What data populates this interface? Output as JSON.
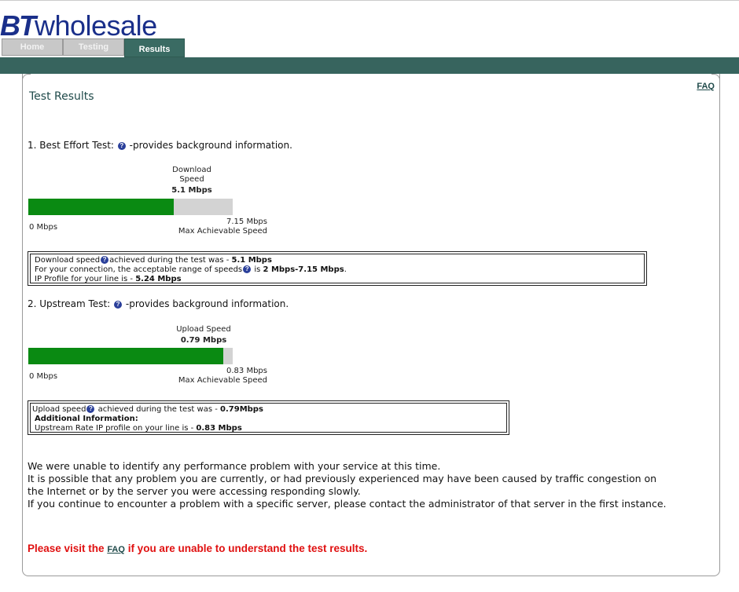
{
  "brand": {
    "bt": "BT",
    "wholesale": "wholesale",
    "color": "#1a2f8a"
  },
  "tabs": [
    {
      "label": "Home",
      "active": false
    },
    {
      "label": "Testing",
      "active": false
    },
    {
      "label": "Results",
      "active": true
    }
  ],
  "faq_link": "FAQ",
  "title": "Test Results",
  "sections": {
    "best_effort": {
      "heading_prefix": "1. Best Effort Test:",
      "heading_suffix": "-provides background information.",
      "speed_label_line1": "Download",
      "speed_label_line2": "Speed",
      "speed_value": "5.1 Mbps",
      "speed_fraction": 0.713,
      "min_label": "0 Mbps",
      "max_value": "7.15 Mbps",
      "max_label": "Max Achievable Speed",
      "info": {
        "line1_prefix": "Download speed",
        "line1_mid": "achieved during the test was - ",
        "line1_value": "5.1 Mbps",
        "line2_prefix": "For your connection, the acceptable range of speeds",
        "line2_mid": " is ",
        "line2_value": "2 Mbps-7.15 Mbps",
        "line2_end": ".",
        "line3_prefix": "IP Profile for your line is - ",
        "line3_value": "5.24 Mbps"
      }
    },
    "upstream": {
      "heading_prefix": "2. Upstream Test:",
      "heading_suffix": "-provides background information.",
      "speed_label": "Upload Speed",
      "speed_value": "0.79 Mbps",
      "speed_fraction": 0.952,
      "min_label": "0 Mbps",
      "max_value": "0.83 Mbps",
      "max_label": "Max Achievable Speed",
      "info": {
        "line1_prefix": "Upload speed",
        "line1_mid": " achieved during the test was - ",
        "line1_value": "0.79Mbps",
        "line2": "Additional Information:",
        "line3_prefix": "Upstream Rate IP profile on your line is - ",
        "line3_value": "0.83 Mbps"
      }
    }
  },
  "message": {
    "line1": "We were unable to identify any performance problem with your service at this time.",
    "line2": "It is possible that any problem you are currently, or had previously experienced may have been caused by traffic congestion on",
    "line3": "the Internet or by the server you were accessing responding slowly.",
    "line4": "If you continue to encounter a problem with a specific server, please contact the administrator of that server in the first instance."
  },
  "visit": {
    "prefix": "Please visit the ",
    "link": "FAQ",
    "suffix": " if you are unable to understand the test results."
  },
  "colors": {
    "teal": "#37645e",
    "bar_green": "#0a8a12",
    "bar_grey": "#d3d3d3",
    "warning_red": "#e01010"
  },
  "icons": {
    "help": "question-circle-icon"
  }
}
